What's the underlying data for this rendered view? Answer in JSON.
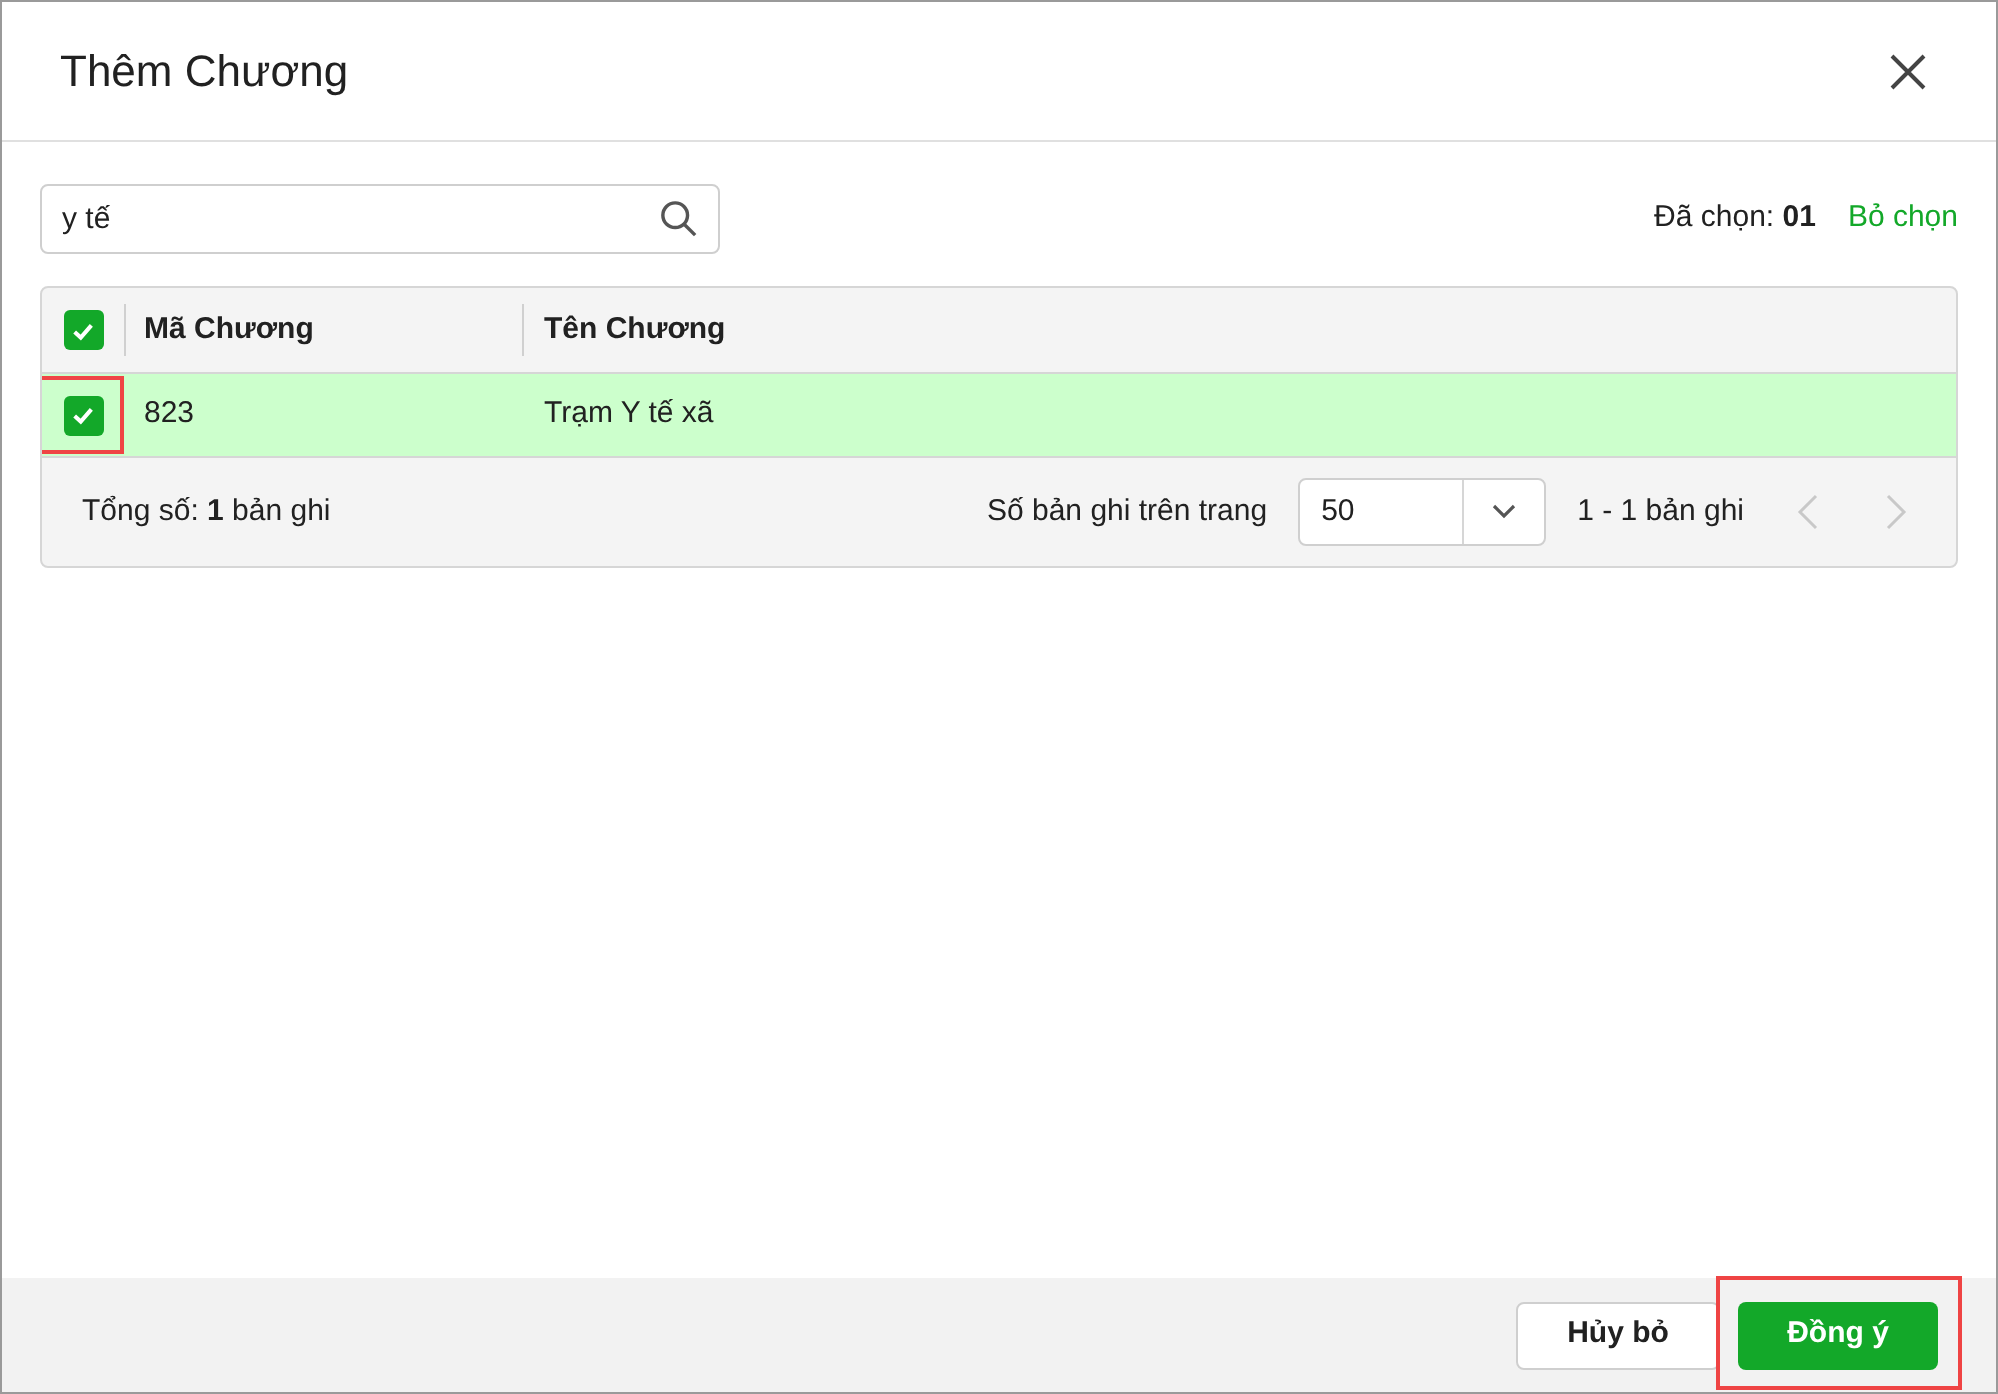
{
  "dialog": {
    "title": "Thêm Chương"
  },
  "search": {
    "value": "y tế"
  },
  "selection": {
    "count_text": "Đã chọn: **01**",
    "clear_link": "Bỏ chọn"
  },
  "table": {
    "select_all_checked": true,
    "columns": [
      "Mã Chương",
      "Tên Chương"
    ],
    "rows": [
      {
        "cells": [
          "823",
          "Trạm Y tế xã"
        ],
        "selected": true,
        "checked": true,
        "highlighted": true
      }
    ]
  },
  "pager": {
    "total": "Tổng số: **1** bản ghi",
    "page_size_label": "Số bản ghi trên trang",
    "page_size": "50",
    "range": "1 - 1 bản ghi",
    "prev_disabled": true,
    "next_disabled": true
  },
  "buttons": [
    {
      "label": "Hủy bỏ",
      "kind": "secondary",
      "highlighted": false
    },
    {
      "label": "Đồng ý",
      "kind": "primary",
      "highlighted": true
    }
  ]
}
